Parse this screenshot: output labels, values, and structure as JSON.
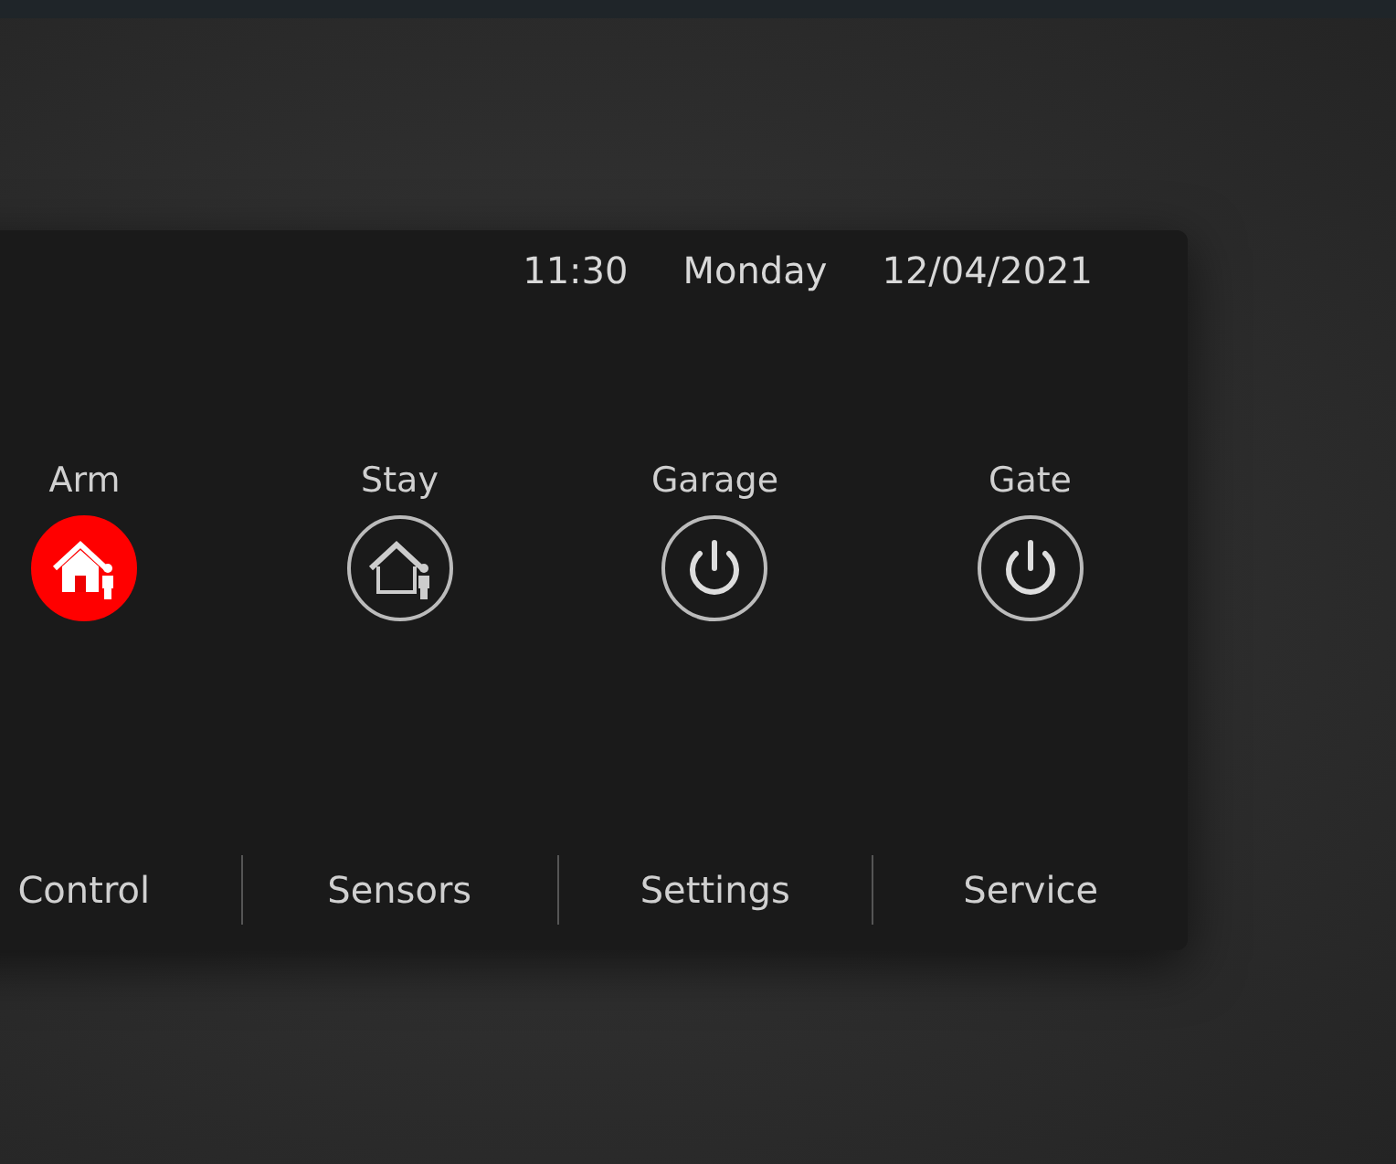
{
  "status": {
    "time": "11:30",
    "day": "Monday",
    "date": "12/04/2021"
  },
  "modes": [
    {
      "label": "Arm",
      "kind": "home",
      "selected": true
    },
    {
      "label": "Stay",
      "kind": "stay",
      "selected": false
    },
    {
      "label": "Garage",
      "kind": "power",
      "selected": false
    },
    {
      "label": "Gate",
      "kind": "power",
      "selected": false
    }
  ],
  "nav": [
    {
      "label": "Control"
    },
    {
      "label": "Sensors"
    },
    {
      "label": "Settings"
    },
    {
      "label": "Service"
    }
  ]
}
